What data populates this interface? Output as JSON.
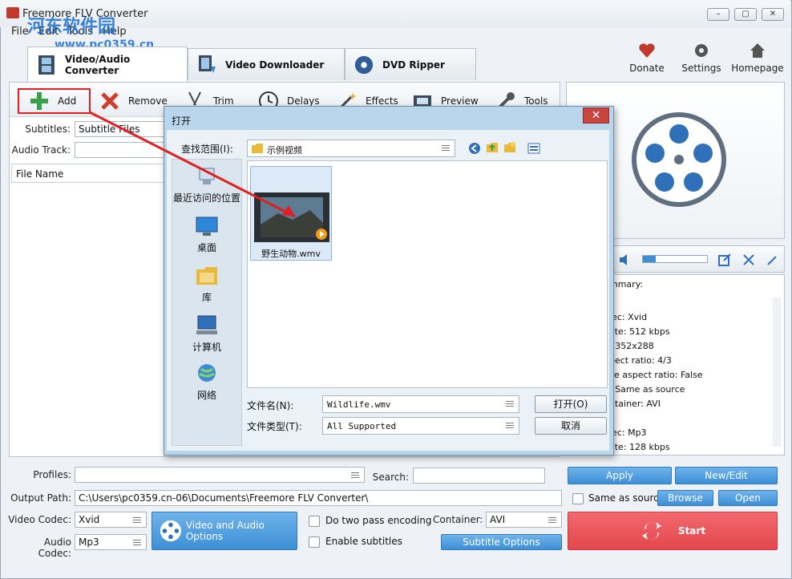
{
  "window": {
    "title": "Freemore FLV Converter",
    "minimize": "–",
    "maximize": "▢",
    "close": "✕"
  },
  "watermark": {
    "line1": "河东软件园",
    "line2": "www.pc0359.cn"
  },
  "menu": [
    "File",
    "Edit",
    "Tools",
    "Help"
  ],
  "tabs": [
    {
      "label": "Video/Audio Converter",
      "active": true
    },
    {
      "label": "Video Downloader",
      "active": false
    },
    {
      "label": "DVD Ripper",
      "active": false
    }
  ],
  "top_actions": {
    "donate": "Donate",
    "settings": "Settings",
    "homepage": "Homepage"
  },
  "toolbar": {
    "add": "Add",
    "remove": "Remove",
    "trim": "Trim",
    "delays": "Delays",
    "effects": "Effects",
    "preview": "Preview",
    "tools": "Tools"
  },
  "left": {
    "subtitles_label": "Subtitles:",
    "subtitles_value": "Subtitle Files",
    "audio_track_label": "Audio Track:",
    "audio_track_value": "",
    "file_name_header": "File Name"
  },
  "summary": {
    "title": "mmary:",
    "lines": [
      "lec: Xvid",
      "ate: 512 kbps",
      ": 352x288",
      "pect ratio: 4/3",
      "ce aspect ratio: False",
      ": Same as source",
      "ntainer: AVI",
      "",
      "lec: Mp3",
      "ate: 128 kbps"
    ]
  },
  "bottom": {
    "profiles_label": "Profiles:",
    "profiles_value": "",
    "search_label": "Search:",
    "search_value": "",
    "output_path_label": "Output Path:",
    "output_path_value": "C:\\Users\\pc0359.cn-06\\Documents\\Freemore FLV Converter\\",
    "video_codec_label": "Video Codec:",
    "video_codec_value": "Xvid",
    "audio_codec_label": "Audio Codec:",
    "audio_codec_value": "Mp3",
    "video_audio_options": "Video and Audio Options",
    "two_pass": "Do two pass encoding",
    "enable_subtitles": "Enable subtitles",
    "container_label": "Container:",
    "container_value": "AVI",
    "subtitle_options": "Subtitle Options",
    "apply": "Apply",
    "new_edit": "New/Edit",
    "same_as_source": "Same as source",
    "browse": "Browse",
    "open": "Open",
    "start": "Start"
  },
  "dialog": {
    "title": "打开",
    "look_in_label": "查找范围(I):",
    "look_in_value": "示例视频",
    "places": [
      "最近访问的位置",
      "桌面",
      "库",
      "计算机",
      "网络"
    ],
    "file_item": "野生动物.wmv",
    "filename_label": "文件名(N):",
    "filename_value": "Wildlife.wmv",
    "filetype_label": "文件类型(T):",
    "filetype_value": "All Supported",
    "open_btn": "打开(O)",
    "cancel_btn": "取消"
  },
  "colors": {
    "accent_blue": "#3d8fd6",
    "start_red": "#e3474d",
    "highlight_red": "#e02020",
    "dialog_frame": "#b9d6ec"
  }
}
